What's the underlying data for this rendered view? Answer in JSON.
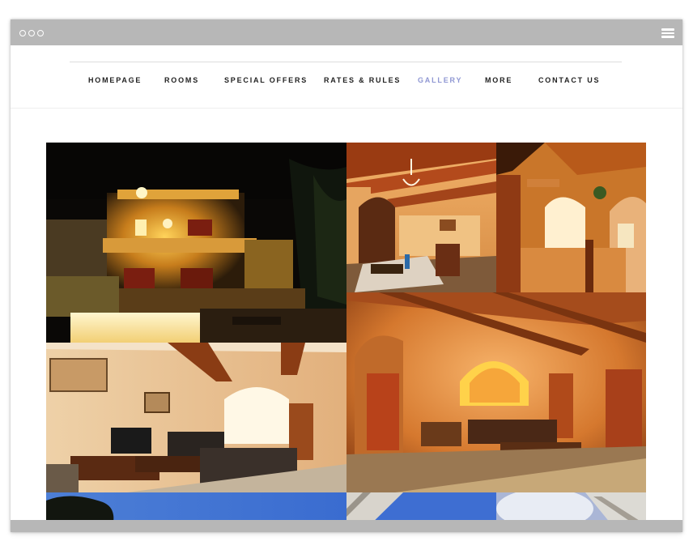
{
  "window": {
    "chrome_color": "#b7b7b7",
    "controls": [
      "dot-icon",
      "dot-icon",
      "dot-icon"
    ],
    "menu_icon": "hamburger-menu-icon"
  },
  "nav": {
    "items": [
      {
        "label": "HOMEPAGE"
      },
      {
        "label": "ROOMS"
      },
      {
        "label": "SPECIAL OFFERS"
      },
      {
        "label": "RATES & RULES"
      },
      {
        "label": "GALLERY",
        "active": true
      },
      {
        "label": "MORE"
      },
      {
        "label": "CONTACT US"
      }
    ],
    "active_color": "#8f97d3",
    "text_color": "#222222"
  },
  "gallery": {
    "tiles": [
      {
        "subject": "farmhouse-exterior-night-photo"
      },
      {
        "subject": "dining-room-photo"
      },
      {
        "subject": "stone-arch-hallway-photo"
      },
      {
        "subject": "living-room-photo"
      },
      {
        "subject": "arched-lounge-photo"
      },
      {
        "subject": "tree-sky-photo"
      },
      {
        "subject": "umbrella-sky-photo"
      },
      {
        "subject": "cloudy-sky-photo"
      }
    ]
  }
}
